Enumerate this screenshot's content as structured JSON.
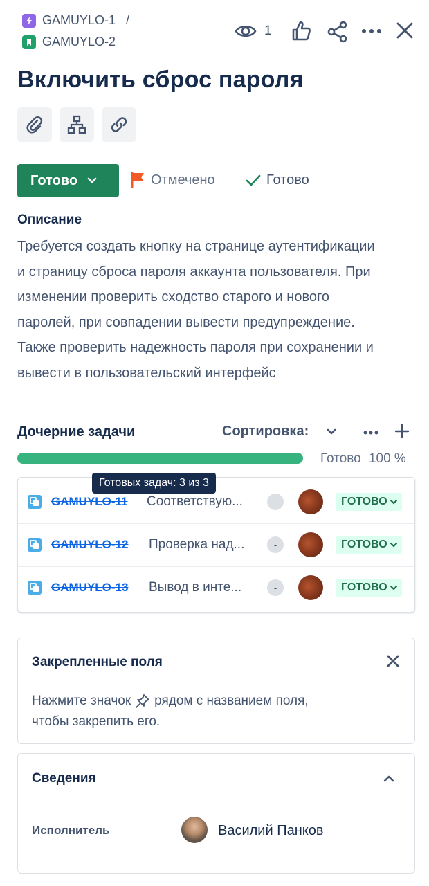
{
  "breadcrumb": {
    "parent_key": "GAMUYLO-1",
    "separator": "/",
    "current_key": "GAMUYLO-2",
    "parent_color": "#8f66e6",
    "current_color": "#22a06b"
  },
  "header": {
    "watchers_count": "1"
  },
  "issue": {
    "title": "Включить сброс пароля"
  },
  "status_bar": {
    "status_label": "Готово",
    "flag_label": "Отмечено",
    "resolution_label": "Готово",
    "status_color": "#1f845a",
    "flag_color": "#f15a24"
  },
  "description": {
    "heading": "Описание",
    "lines": [
      "Требуется создать кнопку на странице аутентификации",
      "и страницу сброса пароля аккаунта пользователя. При",
      "изменении проверить сходство старого и нового",
      "паролей, при совпадении вывести предупреждение.",
      "Также проверить надежность пароля при сохранении и",
      "вывести в пользовательский интерфейс"
    ]
  },
  "child_tasks": {
    "heading": "Дочерние задачи",
    "sort_label": "Сортировка:",
    "progress_label": "Готово",
    "progress_percent": "100 %",
    "progress_value": 1.0,
    "tooltip": "Готовых задач: 3 из 3",
    "items": [
      {
        "key": "GAMUYLO-11",
        "summary": "Соответствую...",
        "priority": "-",
        "status": "ГОТОВО"
      },
      {
        "key": "GAMUYLO-12",
        "summary": "Проверка над...",
        "priority": "-",
        "status": "ГОТОВО"
      },
      {
        "key": "GAMUYLO-13",
        "summary": "Вывод в инте...",
        "priority": "-",
        "status": "ГОТОВО"
      }
    ]
  },
  "pinned_fields": {
    "heading": "Закрепленные поля",
    "text_before": "Нажмите значок",
    "text_after": "рядом с названием поля,",
    "text_line2": "чтобы закрепить его."
  },
  "details": {
    "heading": "Сведения",
    "assignee_label": "Исполнитель",
    "assignee_name": "Василий Панков"
  }
}
